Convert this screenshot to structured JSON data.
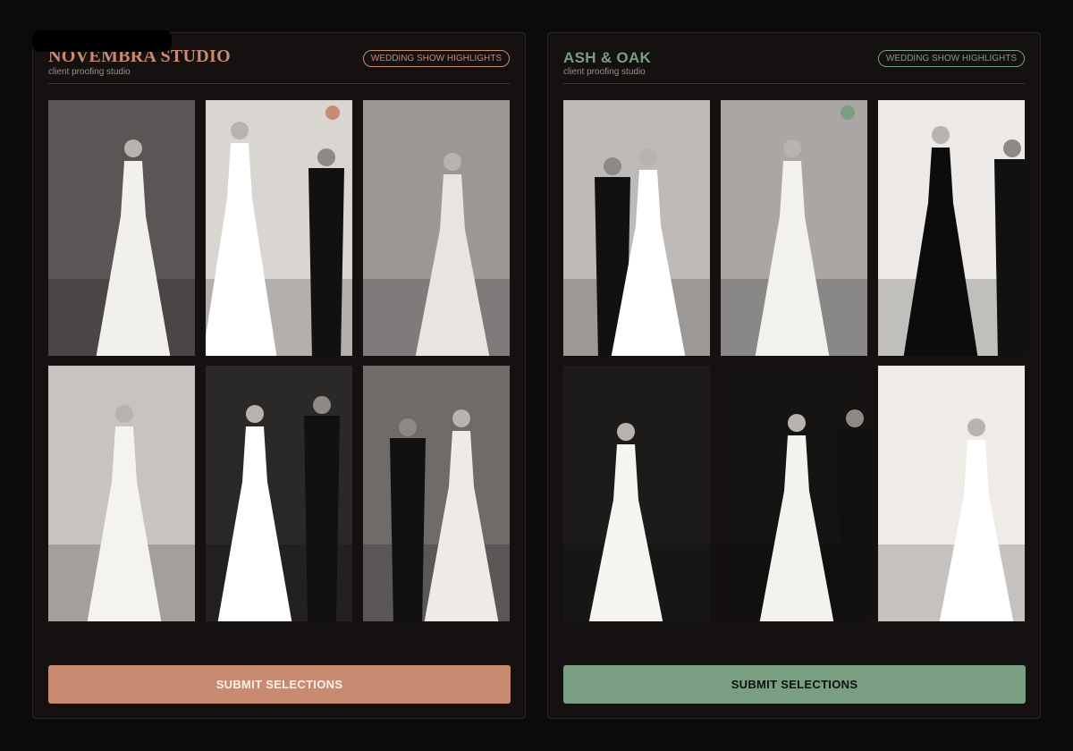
{
  "panels": [
    {
      "studio_name": "NOVEMBRA STUDIO",
      "subtitle": "client proofing studio",
      "badge": "WEDDING SHOW HIGHLIGHTS",
      "accent": "#c88a70",
      "button_text_color": "#fbf2ec",
      "submit_label": "SUBMIT SELECTIONS",
      "selected_photo_index": 1,
      "photos": [
        {
          "name": "bride-portrait-veil"
        },
        {
          "name": "couple-vintage-car"
        },
        {
          "name": "bride-strapless-pose"
        },
        {
          "name": "bride-ballgown-necklace"
        },
        {
          "name": "couple-long-sleeve-gown"
        },
        {
          "name": "couple-street-car"
        }
      ]
    },
    {
      "studio_name": "ASH & OAK",
      "subtitle": "client proofing studio",
      "badge": "WEDDING SHOW HIGHLIGHTS",
      "accent": "#7a9e82",
      "button_text_color": "#0d1110",
      "submit_label": "SUBMIT SELECTIONS",
      "selected_photo_index": 1,
      "photos": [
        {
          "name": "couple-in-car"
        },
        {
          "name": "bride-long-veil"
        },
        {
          "name": "couple-black-gown"
        },
        {
          "name": "bride-ruffled-gown"
        },
        {
          "name": "couple-lace-gown"
        },
        {
          "name": "bride-bouquet-studio"
        }
      ]
    }
  ]
}
